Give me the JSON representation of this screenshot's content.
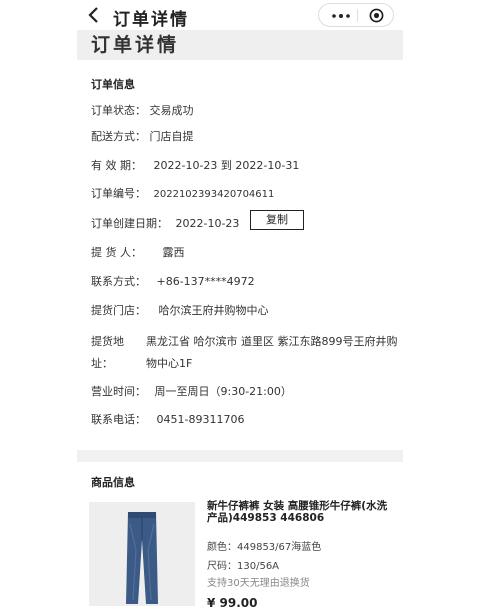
{
  "nav": {
    "title": "订单详情",
    "icons": {
      "back": "back-chevron-icon",
      "more": "more-dots-icon",
      "close": "close-target-icon"
    }
  },
  "page": {
    "title": "订单详情"
  },
  "order": {
    "section_title": "订单信息",
    "rows": [
      {
        "label": "订单状态：",
        "value": "交易成功"
      },
      {
        "label": "配送方式：",
        "value": "门店自提"
      },
      {
        "label": "有 效 期：",
        "value": "2022-10-23 到 2022-10-31"
      },
      {
        "label": "订单编号：",
        "value": "2022102393420704611"
      },
      {
        "label": "订单创建日期：",
        "value": "2022-10-23"
      },
      {
        "label": "提 货 人：",
        "value": "露西"
      },
      {
        "label": "联系方式：",
        "value": "+86-137****4972"
      },
      {
        "label": "提货门店：",
        "value": "哈尔滨王府井购物中心"
      }
    ],
    "copy_label": "复制",
    "address": {
      "label_1": "提货地",
      "label_2": "址：",
      "line_1": "黑龙江省 哈尔滨市 道里区 紫江东路899号王府井购",
      "line_2": "物中心1F"
    },
    "hours": {
      "label": "营业时间：",
      "value": "周一至周日（9:30-21:00）"
    },
    "phone": {
      "label": "联系电话：",
      "value": "0451-89311706"
    }
  },
  "product": {
    "section_title": "商品信息",
    "name": "新牛仔裤裤 女装 高腰锥形牛仔裤(水洗产品)449853 446806",
    "color": "颜色：449853/67海蓝色",
    "size": "尺码：130/56A",
    "note": "支持30天无理由退换货",
    "price": "¥ 99.00",
    "image": "jeans-product-image"
  },
  "colors": {
    "band": "#efefef",
    "gap": "#f1f1f1",
    "denim": "#3c5a86"
  }
}
